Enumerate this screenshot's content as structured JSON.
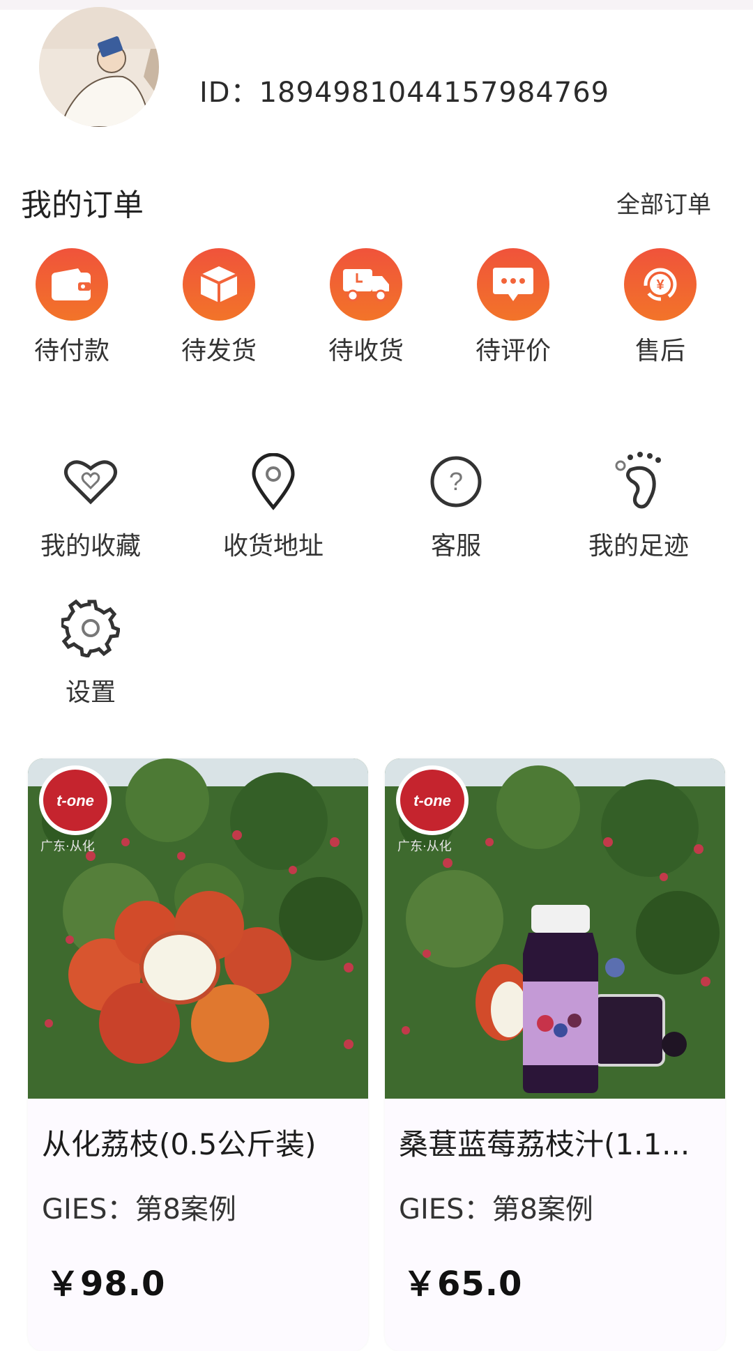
{
  "profile": {
    "id_text": "ID：1894981044157984769"
  },
  "orders": {
    "title": "我的订单",
    "all_orders": "全部订单",
    "items": [
      {
        "label": "待付款",
        "icon": "wallet-icon"
      },
      {
        "label": "待发货",
        "icon": "box-icon"
      },
      {
        "label": "待收货",
        "icon": "truck-icon"
      },
      {
        "label": "待评价",
        "icon": "chat-icon"
      },
      {
        "label": "售后",
        "icon": "yen-refund-icon"
      }
    ],
    "accent": "#f0533b"
  },
  "services": [
    {
      "label": "我的收藏",
      "icon": "heart-icon"
    },
    {
      "label": "收货地址",
      "icon": "location-pin-icon"
    },
    {
      "label": "客服",
      "icon": "question-icon"
    },
    {
      "label": "我的足迹",
      "icon": "footprint-icon"
    },
    {
      "label": "设置",
      "icon": "gear-icon"
    }
  ],
  "products": [
    {
      "name": "从化荔枝(0.5公斤装)",
      "sub": "GIES：第8案例",
      "price": "￥98.0",
      "brand": "t-one",
      "region": "广东·从化"
    },
    {
      "name": "桑葚蓝莓荔枝汁(1.1...",
      "sub": "GIES：第8案例",
      "price": "￥65.0",
      "brand": "t-one",
      "region": "广东·从化"
    }
  ]
}
